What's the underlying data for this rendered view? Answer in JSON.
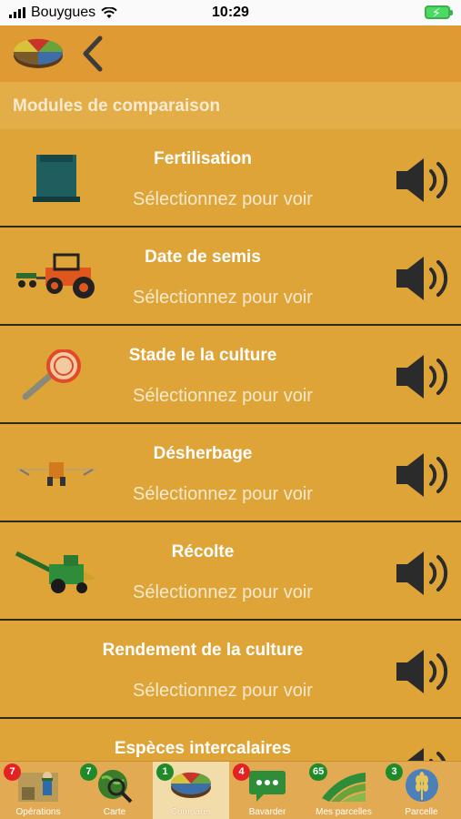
{
  "status_bar": {
    "carrier": "Bouygues",
    "time": "10:29"
  },
  "header": {
    "back_icon": "chevron-left-icon",
    "logo_icon": "pie-chart-logo-icon"
  },
  "section": {
    "title": "Modules de comparaison"
  },
  "modules": [
    {
      "title": "Fertilisation",
      "subtitle": "Sélectionnez pour voir",
      "icon": "fertilizer-tank-icon"
    },
    {
      "title": "Date de semis",
      "subtitle": "Sélectionnez pour voir",
      "icon": "tractor-seeder-icon"
    },
    {
      "title": "Stade le la culture",
      "subtitle": "Sélectionnez pour voir",
      "icon": "magnifier-icon"
    },
    {
      "title": "Désherbage",
      "subtitle": "Sélectionnez pour voir",
      "icon": "sprayer-icon"
    },
    {
      "title": "Récolte",
      "subtitle": "Sélectionnez pour voir",
      "icon": "harvester-icon"
    },
    {
      "title": "Rendement de la culture",
      "subtitle": "Sélectionnez pour voir",
      "icon": "none"
    },
    {
      "title": "Espèces intercalaires",
      "subtitle": "",
      "icon": "none"
    }
  ],
  "tabs": [
    {
      "label": "Opérations",
      "badge": "7",
      "badge_color": "#e32323",
      "icon": "farmer-icon",
      "active": false
    },
    {
      "label": "Carte",
      "badge": "7",
      "badge_color": "#1e8a2a",
      "icon": "globe-search-icon",
      "active": false
    },
    {
      "label": "Comparer",
      "badge": "1",
      "badge_color": "#1e8a2a",
      "icon": "pie-chart-icon",
      "active": true
    },
    {
      "label": "Bavarder",
      "badge": "4",
      "badge_color": "#e32323",
      "icon": "chat-bubble-icon",
      "active": false
    },
    {
      "label": "Mes parcelles",
      "badge": "65",
      "badge_color": "#1e8a2a",
      "icon": "fields-icon",
      "active": false
    },
    {
      "label": "Parcelle",
      "badge": "3",
      "badge_color": "#1e8a2a",
      "icon": "wheat-icon",
      "active": false
    }
  ],
  "colors": {
    "background": "#dfa437",
    "header": "#e09a33",
    "tabbar": "#e2ab53",
    "divider": "#2d2a22"
  }
}
